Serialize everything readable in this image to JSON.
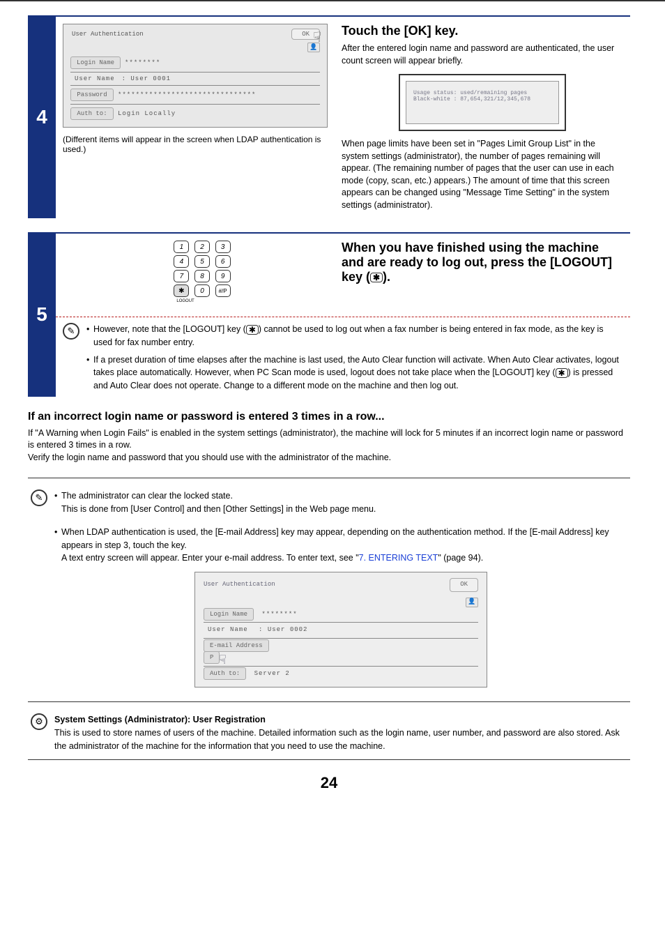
{
  "step4": {
    "number": "4",
    "panel": {
      "title": "User Authentication",
      "ok": "OK",
      "login_name_btn": "Login Name",
      "login_name_val": "********",
      "user_name_label": "User Name",
      "user_name_val": ": User 0001",
      "password_btn": "Password",
      "password_val": "*******************************",
      "auth_to_btn": "Auth to:",
      "auth_to_val": "Login Locally"
    },
    "caption": "(Different items will appear in the screen when LDAP authentication is used.)",
    "heading": "Touch the [OK] key.",
    "body1": "After the entered login name and password are authenticated, the user count screen will appear briefly.",
    "usage_line1": "Usage status: used/remaining pages",
    "usage_line2": "Black-white : 87,654,321/12,345,678",
    "body2": "When page limits have been set in \"Pages Limit Group List\" in the system settings (administrator), the number of pages remaining will appear. (The remaining number of pages that the user can use in each mode (copy, scan, etc.) appears.) The amount of time that this screen appears can be changed using \"Message Time Setting\" in the system settings (administrator)."
  },
  "step5": {
    "number": "5",
    "heading_pre": "When you have finished using the machine and are ready to log out, press the [LOGOUT] key (",
    "heading_post": ").",
    "keypad": {
      "r1": [
        "1",
        "2",
        "3"
      ],
      "r2": [
        "4",
        "5",
        "6"
      ],
      "r3": [
        "7",
        "8",
        "9"
      ],
      "r4": [
        "",
        "0",
        "#/P"
      ],
      "logout_label": "LOGOUT"
    },
    "note1_pre": "However, note that the [LOGOUT] key (",
    "note1_post": ") cannot be used to log out when a fax number is being entered in fax mode, as the key is used for fax number entry.",
    "note2_pre": "If a preset duration of time elapses after the machine is last used, the Auto Clear function will activate. When Auto Clear activates, logout takes place automatically. However, when PC Scan mode is used, logout does not take place when the [LOGOUT] key (",
    "note2_post": ") is pressed and Auto Clear does not operate. Change to a different mode on the machine and then log out."
  },
  "incorrect": {
    "heading": "If an incorrect login name or password is entered 3 times in a row...",
    "body": "If \"A Warning when Login Fails\" is enabled in the system settings (administrator), the machine will lock for 5 minutes if an incorrect login name or password is entered 3 times in a row.\nVerify the login name and password that you should use with the administrator of the machine."
  },
  "notes": {
    "admin_clear": "The administrator can clear the locked state.",
    "admin_clear2": "This is done from [User Control] and then [Other Settings] in the Web page menu.",
    "ldap_pre": "When LDAP authentication is used, the [E-mail Address] key may appear, depending on the authentication method. If the [E-mail Address] key appears in step 3, touch the key.",
    "ldap_post_pre": "A text entry screen will appear. Enter your e-mail address. To enter text, see \"",
    "ldap_link": "7. ENTERING TEXT",
    "ldap_post_post": "\" (page 94)."
  },
  "ldap_panel": {
    "title": "User Authentication",
    "ok": "OK",
    "login_name_btn": "Login Name",
    "login_name_val": "********",
    "user_name_label": "User Name",
    "user_name_val": ": User 0002",
    "email_btn": "E-mail Address",
    "p_label": "P",
    "auth_to_btn": "Auth to:",
    "auth_to_val": "Server 2"
  },
  "sys_settings": {
    "heading": "System Settings (Administrator): User Registration",
    "body": "This is used to store names of users of the machine. Detailed information such as the login name, user number, and password are also stored. Ask the administrator of the machine for the information that you need to use the machine."
  },
  "pagenum": "24"
}
